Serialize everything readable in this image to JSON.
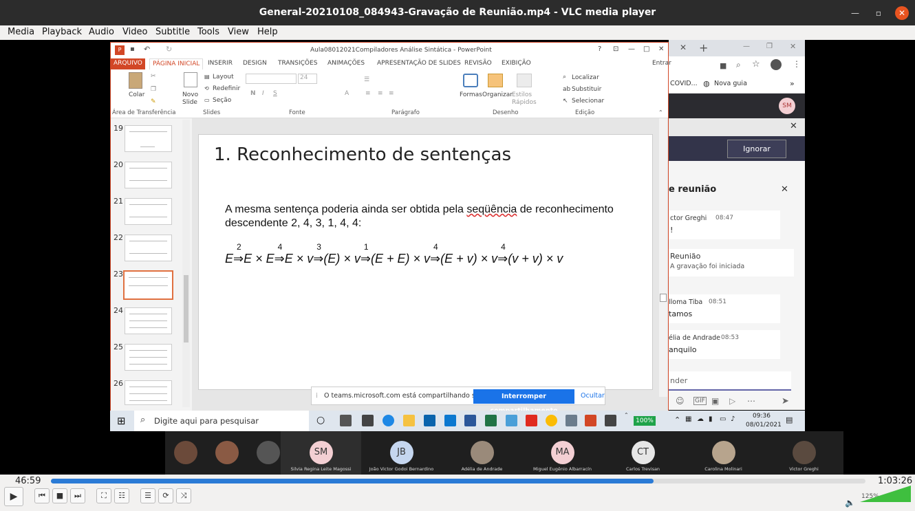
{
  "window": {
    "title": "General-20210108_084943-Gravação de Reunião.mp4 - VLC media player"
  },
  "menu": [
    "Media",
    "Playback",
    "Audio",
    "Video",
    "Subtitle",
    "Tools",
    "View",
    "Help"
  ],
  "ppt": {
    "title": "Aula08012021Compiladores Análise Sintática - PowerPoint",
    "tabs": [
      "ARQUIVO",
      "PÁGINA INICIAL",
      "INSERIR",
      "DESIGN",
      "TRANSIÇÕES",
      "ANIMAÇÕES",
      "APRESENTAÇÃO DE SLIDES",
      "REVISÃO",
      "EXIBIÇÃO"
    ],
    "signin": "Entrar",
    "ribbon": {
      "paste": "Colar",
      "new_slide": "Novo\nSlide",
      "layout": "Layout",
      "reset": "Redefinir",
      "section": "Seção",
      "font_size": "24",
      "shapes": "Formas",
      "arrange": "Organizar",
      "quick_styles": "Estilos\nRápidos",
      "find": "Localizar",
      "replace": "Substituir",
      "select": "Selecionar",
      "groups": [
        "Área de Transferência",
        "Slides",
        "Fonte",
        "Parágrafo",
        "Desenho",
        "Edição"
      ]
    },
    "thumb_numbers": [
      "19",
      "20",
      "21",
      "22",
      "23",
      "24",
      "25",
      "26"
    ],
    "slide": {
      "title": "1. Reconhecimento de sentenças",
      "body_pre": "A mesma sentença poderia ainda ser obtida pela ",
      "body_word": "seqüência",
      "body_post": " de reconhecimento descendente 2, 4, 3, 1, 4, 4:",
      "formula": [
        {
          "t": "E",
          "s": "2"
        },
        {
          "t": "E × E",
          "s": "4"
        },
        {
          "t": "E × v",
          "s": "3"
        },
        {
          "t": "(E) × v",
          "s": "1"
        },
        {
          "t": "(E + E) × v",
          "s": "4"
        },
        {
          "t": "(E + v) × v",
          "s": "4"
        },
        {
          "t": "(v + v) × v",
          "s": ""
        }
      ]
    },
    "share": {
      "text": "O teams.microsoft.com está compartilhando sua tela.",
      "stop": "Interromper compartilhamento",
      "hide": "Ocultar"
    }
  },
  "chrome": {
    "tab1": "COVID...",
    "newtab": "Nova guia"
  },
  "teams": {
    "ignore": "Ignorar",
    "avatar": "SM",
    "panel_title": "e reunião",
    "messages": [
      {
        "name": "ctor Greghi",
        "time": "08:47",
        "text": "!"
      },
      {
        "name": "Reunião",
        "time": "",
        "text": "A gravação foi iniciada"
      },
      {
        "name": "lloma Tiba",
        "time": "08:51",
        "text": "tamos"
      },
      {
        "name": "élia de Andrade",
        "time": "08:53",
        "text": "anquilo"
      }
    ],
    "reply": "nder"
  },
  "taskbar": {
    "search": "Digite aqui para pesquisar",
    "zoom": "100%",
    "time": "09:36",
    "date": "08/01/2021"
  },
  "participants": [
    {
      "name": "",
      "initials": "",
      "color": "#6b4a3a"
    },
    {
      "name": "",
      "initials": "",
      "color": "#8a5a44"
    },
    {
      "name": "",
      "initials": "",
      "color": "#555"
    },
    {
      "name": "Silvia Regina Leite Magossi",
      "initials": "SM",
      "color": "#f3cfd3"
    },
    {
      "name": "João Victor Godoi Bernardino",
      "initials": "JB",
      "color": "#c5d6ef"
    },
    {
      "name": "Adélia de Andrade",
      "initials": "",
      "color": "#9a8a7a"
    },
    {
      "name": "Miguel Eugênio Albarracín",
      "initials": "MA",
      "color": "#f3cfd3"
    },
    {
      "name": "Carlos Trevisan",
      "initials": "CT",
      "color": "#e6e6e6"
    },
    {
      "name": "Carolina Molinari",
      "initials": "",
      "color": "#b7a48d"
    },
    {
      "name": "Victor Greghi",
      "initials": "",
      "color": "#5a4a3f"
    }
  ],
  "player": {
    "elapsed": "46:59",
    "total": "1:03:26",
    "progress": 0.74,
    "volume": "125%",
    "volume_level": 1.0
  }
}
